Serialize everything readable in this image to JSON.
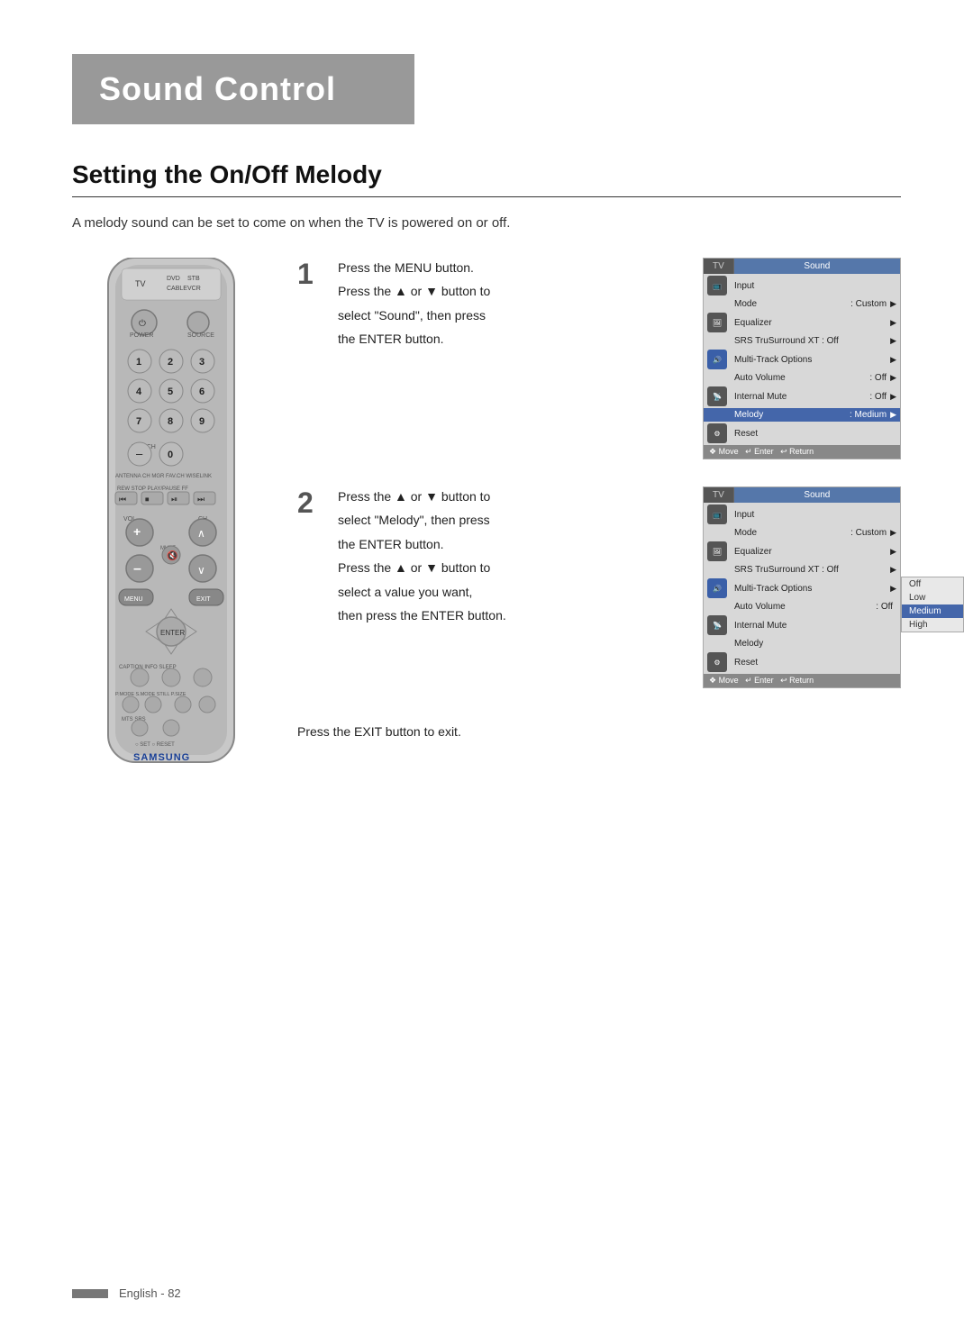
{
  "header": {
    "title": "Sound Control"
  },
  "section": {
    "title": "Setting the On/Off Melody",
    "description": "A melody sound can be set to come on when the TV is powered on or off."
  },
  "steps": [
    {
      "number": "1",
      "lines": [
        "Press the MENU button.",
        "Press the ▲ or ▼ button to",
        "select “Sound”, then press",
        "the ENTER button."
      ]
    },
    {
      "number": "2",
      "lines": [
        "Press the ▲ or ▼ button to",
        "select “Melody”, then press",
        "the ENTER button.",
        "Press the ▲ or ▼ button to",
        "select a value you want,",
        "then press the ENTER button."
      ]
    }
  ],
  "exit_step": "Press the EXIT button to exit.",
  "menu1": {
    "tv_label": "TV",
    "sound_label": "Sound",
    "rows": [
      {
        "label": "Mode",
        "value": ": Custom",
        "has_arrow": true,
        "icon": "input",
        "highlighted": false
      },
      {
        "label": "Equalizer",
        "value": "",
        "has_arrow": true,
        "icon": "",
        "highlighted": false
      },
      {
        "label": "SRS TruSurround XT : Off",
        "value": "",
        "has_arrow": true,
        "icon": "",
        "highlighted": false
      },
      {
        "label": "Multi-Track Options",
        "value": "",
        "has_arrow": true,
        "icon": "",
        "highlighted": false
      },
      {
        "label": "Auto Volume",
        "value": ": Off",
        "has_arrow": true,
        "icon": "sound",
        "highlighted": false
      },
      {
        "label": "Internal Mute",
        "value": ": Off",
        "has_arrow": true,
        "icon": "",
        "highlighted": false
      },
      {
        "label": "Melody",
        "value": ": Medium",
        "has_arrow": true,
        "icon": "channel",
        "highlighted": true
      },
      {
        "label": "Reset",
        "value": "",
        "has_arrow": false,
        "icon": "",
        "highlighted": false
      }
    ],
    "footer": "❖ Move  ↵ Enter  ↩ Return"
  },
  "menu2": {
    "tv_label": "TV",
    "sound_label": "Sound",
    "rows": [
      {
        "label": "Mode",
        "value": ": Custom",
        "has_arrow": true,
        "icon": "input",
        "highlighted": false
      },
      {
        "label": "Equalizer",
        "value": "",
        "has_arrow": true,
        "icon": "",
        "highlighted": false
      },
      {
        "label": "SRS TruSurround XT : Off",
        "value": "",
        "has_arrow": true,
        "icon": "",
        "highlighted": false
      },
      {
        "label": "Multi-Track Options",
        "value": "",
        "has_arrow": true,
        "icon": "",
        "highlighted": false
      },
      {
        "label": "Auto Volume",
        "value": ": Off",
        "has_arrow": true,
        "icon": "sound",
        "highlighted": false
      },
      {
        "label": "Internal Mute",
        "value": "",
        "has_arrow": false,
        "icon": "",
        "highlighted": false
      },
      {
        "label": "Melody",
        "value": "",
        "has_arrow": false,
        "icon": "channel",
        "highlighted": false
      },
      {
        "label": "Reset",
        "value": "",
        "has_arrow": false,
        "icon": "",
        "highlighted": false
      }
    ],
    "submenu": [
      "Off",
      "Low",
      "Medium",
      "High"
    ],
    "submenu_selected": "Medium",
    "footer": "❖ Move  ↵ Enter  ↩ Return"
  },
  "footer": {
    "text": "English - 82"
  }
}
